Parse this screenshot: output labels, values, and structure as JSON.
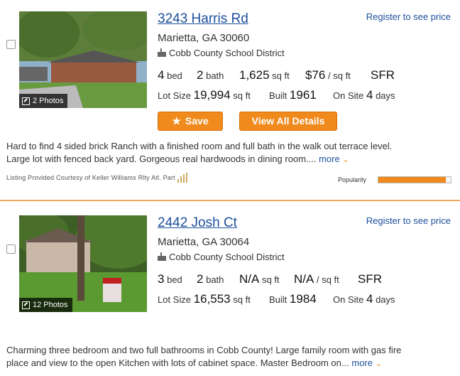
{
  "listings": [
    {
      "address": "3243 Harris Rd",
      "price_text": "Register to see price",
      "city": "Marietta, GA 30060",
      "school": "Cobb County School District",
      "photo_count": "2 Photos",
      "beds": "4",
      "beds_label": "bed",
      "baths": "2",
      "baths_label": "bath",
      "sqft": "1,625",
      "sqft_label": "sq ft",
      "price_sqft": "$76",
      "price_sqft_label": "/ sq ft",
      "type": "SFR",
      "lot_label": "Lot Size",
      "lot": "19,994",
      "lot_unit": "sq ft",
      "built_label": "Built",
      "built": "1961",
      "onsite_label": "On Site",
      "onsite": "4",
      "onsite_unit": "days",
      "save_label": "Save",
      "details_label": "View All Details",
      "description": "Hard to find 4 sided brick Ranch with a finished room and full bath in the walk out terrace level. Large lot with fenced back yard. Gorgeous real hardwoods in dining room....",
      "more_label": "more",
      "courtesy": "Listing Provided Courtesy of Keller Williams Rlty Atl. Part",
      "popularity_label": "Popularity",
      "popularity": 0.93
    },
    {
      "address": "2442 Josh Ct",
      "price_text": "Register to see price",
      "city": "Marietta, GA 30064",
      "school": "Cobb County School District",
      "photo_count": "12 Photos",
      "beds": "3",
      "beds_label": "bed",
      "baths": "2",
      "baths_label": "bath",
      "sqft": "N/A",
      "sqft_label": "sq ft",
      "price_sqft": "N/A",
      "price_sqft_label": "/ sq ft",
      "type": "SFR",
      "lot_label": "Lot Size",
      "lot": "16,553",
      "lot_unit": "sq ft",
      "built_label": "Built",
      "built": "1984",
      "onsite_label": "On Site",
      "onsite": "4",
      "onsite_unit": "days",
      "description": "Charming three bedroom and two full bathrooms in Cobb County! Large family room with gas fire place and view to the open Kitchen with lots of cabinet space. Master Bedroom on...",
      "more_label": "more"
    }
  ],
  "colors": {
    "accent": "#f08a1c",
    "link": "#1c4f9c",
    "divider": "#f0a860"
  },
  "icons": {
    "save": "star-icon",
    "photos": "expand-icon",
    "school": "school-icon",
    "more": "chevron-down-icon"
  }
}
